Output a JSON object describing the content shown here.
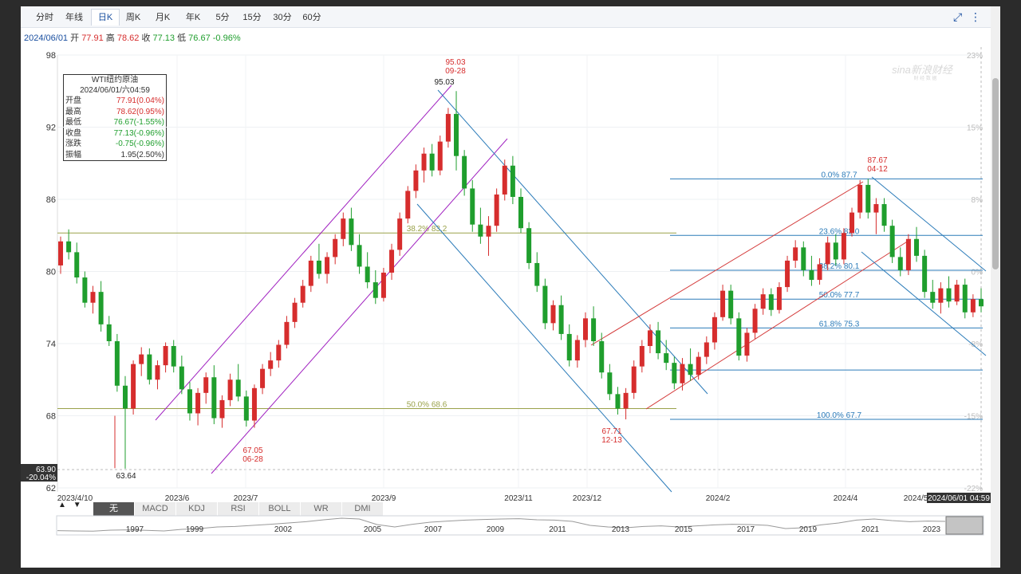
{
  "tabs": [
    {
      "label": "分时"
    },
    {
      "label": "年线"
    },
    {
      "label": "日K",
      "active": true
    },
    {
      "label": "周K"
    },
    {
      "label": "月K"
    },
    {
      "label": "年K"
    },
    {
      "label": "5分"
    },
    {
      "label": "15分"
    },
    {
      "label": "30分"
    },
    {
      "label": "60分"
    }
  ],
  "toolbar": {
    "expand_icon": "fullscreen-icon",
    "more_icon": "more-vertical-icon",
    "expand_glyph": "⤢",
    "more_glyph": "⋮"
  },
  "quote": {
    "date": "2024/06/01",
    "open_label": "开",
    "open": "77.91",
    "high_label": "高",
    "high": "78.62",
    "close_label": "收",
    "close": "77.13",
    "low_label": "低",
    "low": "76.67",
    "change": "-0.96%"
  },
  "infobox": {
    "title": "WTI纽约原油",
    "datetime": "2024/06/01/六04:59",
    "rows": [
      {
        "label": "开盘",
        "value": "77.91(0.04%)",
        "color": "red"
      },
      {
        "label": "最高",
        "value": "78.62(0.95%)",
        "color": "red"
      },
      {
        "label": "最低",
        "value": "76.67(-1.55%)",
        "color": "green"
      },
      {
        "label": "收盘",
        "value": "77.13(-0.96%)",
        "color": "green"
      },
      {
        "label": "涨跌",
        "value": "-0.75(-0.96%)",
        "color": "green"
      },
      {
        "label": "振幅",
        "value": "1.95(2.50%)",
        "color": "black"
      }
    ]
  },
  "chart_data": {
    "type": "candlestick",
    "ylim": [
      62,
      98
    ],
    "y_ticks": [
      98,
      92,
      86,
      80,
      74,
      68,
      62
    ],
    "right_pct_ticks": [
      "23%",
      "15%",
      "8%",
      "0%",
      "-8%",
      "-15%",
      "-22%"
    ],
    "x_tick_labels": [
      "2023/4/10",
      "2023/6",
      "2023/7",
      "2023/9",
      "2023/11",
      "2023/12",
      "2024/2",
      "2024/4",
      "2024/5"
    ],
    "current_price_label": "63.90",
    "current_pct_label": "-20.04%",
    "crosshair_time_label": "2024/06/01 04:59",
    "annotations": [
      {
        "text": "95.03",
        "sub": "09-28",
        "kind": "high"
      },
      {
        "text": "95.03",
        "kind": "peak"
      },
      {
        "text": "67.05",
        "sub": "06-28",
        "kind": "low"
      },
      {
        "text": "67.71",
        "sub": "12-13",
        "kind": "low"
      },
      {
        "text": "87.67",
        "sub": "04-12",
        "kind": "high"
      },
      {
        "text": "63.64",
        "kind": "min"
      }
    ],
    "fib_levels_left": [
      {
        "label": "38.2% 83.2",
        "value": 83.2
      },
      {
        "label": "50.0% 68.6",
        "value": 68.6
      }
    ],
    "fib_levels_right": [
      {
        "label": "0.0% 87.7",
        "value": 87.7
      },
      {
        "label": "23.6% 83.0",
        "value": 83.0
      },
      {
        "label": "38.2% 80.1",
        "value": 80.1
      },
      {
        "label": "50.0% 77.7",
        "value": 77.7
      },
      {
        "label": "61.8% 75.3",
        "value": 75.3
      },
      {
        "label": "",
        "value": 71.8
      },
      {
        "label": "100.0% 67.7",
        "value": 67.7
      }
    ],
    "candles_ohlc": [
      [
        80.5,
        82.9,
        79.8,
        82.5
      ],
      [
        82.5,
        83.5,
        81.0,
        81.6
      ],
      [
        81.6,
        82.4,
        79.0,
        79.5
      ],
      [
        79.5,
        80.0,
        77.0,
        77.4
      ],
      [
        77.4,
        78.8,
        76.5,
        78.3
      ],
      [
        78.3,
        79.2,
        75.0,
        75.6
      ],
      [
        75.6,
        76.3,
        73.8,
        74.2
      ],
      [
        74.2,
        74.8,
        70.0,
        70.5
      ],
      [
        70.5,
        71.3,
        63.6,
        68.6
      ],
      [
        68.6,
        72.6,
        68.1,
        72.3
      ],
      [
        72.3,
        73.7,
        71.3,
        73.1
      ],
      [
        73.1,
        73.6,
        70.6,
        71.0
      ],
      [
        71.0,
        72.6,
        70.2,
        72.2
      ],
      [
        72.2,
        74.1,
        71.6,
        73.8
      ],
      [
        73.8,
        74.3,
        71.6,
        72.1
      ],
      [
        72.1,
        73.0,
        69.8,
        70.2
      ],
      [
        70.2,
        70.8,
        67.6,
        68.2
      ],
      [
        68.2,
        70.3,
        67.2,
        69.9
      ],
      [
        69.9,
        71.6,
        69.0,
        71.2
      ],
      [
        71.2,
        72.2,
        67.3,
        67.8
      ],
      [
        67.8,
        69.7,
        67.0,
        69.3
      ],
      [
        69.3,
        71.5,
        68.8,
        71.0
      ],
      [
        71.0,
        72.3,
        69.2,
        69.6
      ],
      [
        69.6,
        70.1,
        67.1,
        67.6
      ],
      [
        67.6,
        70.6,
        67.0,
        70.3
      ],
      [
        70.3,
        72.3,
        69.8,
        71.9
      ],
      [
        71.9,
        73.3,
        71.3,
        72.6
      ],
      [
        72.6,
        74.3,
        72.0,
        73.9
      ],
      [
        73.9,
        76.3,
        73.6,
        75.8
      ],
      [
        75.8,
        77.8,
        75.3,
        77.4
      ],
      [
        77.4,
        79.3,
        77.0,
        78.8
      ],
      [
        78.8,
        81.3,
        78.3,
        80.9
      ],
      [
        80.9,
        82.3,
        79.4,
        79.8
      ],
      [
        79.8,
        81.6,
        79.0,
        81.2
      ],
      [
        81.2,
        83.1,
        80.6,
        82.7
      ],
      [
        82.7,
        84.9,
        82.1,
        84.4
      ],
      [
        84.4,
        85.3,
        81.7,
        82.2
      ],
      [
        82.2,
        83.1,
        79.8,
        80.4
      ],
      [
        80.4,
        81.6,
        78.6,
        79.1
      ],
      [
        79.1,
        80.1,
        77.3,
        77.8
      ],
      [
        77.8,
        80.3,
        77.5,
        79.9
      ],
      [
        79.9,
        82.3,
        79.3,
        81.8
      ],
      [
        81.8,
        84.9,
        81.3,
        84.4
      ],
      [
        84.4,
        87.1,
        84.0,
        86.7
      ],
      [
        86.7,
        88.9,
        86.1,
        88.4
      ],
      [
        88.4,
        90.3,
        87.4,
        89.8
      ],
      [
        89.8,
        90.6,
        87.9,
        88.4
      ],
      [
        88.4,
        91.3,
        88.0,
        90.8
      ],
      [
        90.8,
        93.6,
        90.3,
        93.1
      ],
      [
        93.1,
        95.0,
        88.4,
        89.6
      ],
      [
        89.6,
        90.1,
        86.3,
        86.9
      ],
      [
        86.9,
        87.6,
        83.3,
        83.9
      ],
      [
        83.9,
        85.3,
        82.3,
        82.9
      ],
      [
        82.9,
        84.6,
        81.3,
        83.8
      ],
      [
        83.8,
        86.9,
        83.3,
        86.4
      ],
      [
        86.4,
        89.3,
        85.9,
        88.8
      ],
      [
        88.8,
        89.6,
        85.6,
        86.2
      ],
      [
        86.2,
        86.9,
        83.2,
        83.6
      ],
      [
        83.6,
        84.1,
        80.2,
        80.7
      ],
      [
        80.7,
        81.6,
        78.3,
        78.8
      ],
      [
        78.8,
        79.4,
        75.2,
        75.7
      ],
      [
        75.7,
        77.6,
        75.1,
        77.2
      ],
      [
        77.2,
        78.0,
        74.3,
        74.8
      ],
      [
        74.8,
        75.6,
        72.1,
        72.6
      ],
      [
        72.6,
        74.7,
        72.0,
        74.3
      ],
      [
        74.3,
        76.6,
        73.7,
        76.1
      ],
      [
        76.1,
        77.1,
        73.8,
        74.2
      ],
      [
        74.2,
        74.9,
        71.1,
        71.6
      ],
      [
        71.6,
        72.3,
        69.3,
        69.8
      ],
      [
        69.8,
        70.4,
        68.1,
        68.6
      ],
      [
        68.6,
        70.3,
        67.7,
        69.9
      ],
      [
        69.9,
        72.6,
        69.4,
        72.1
      ],
      [
        72.1,
        74.3,
        71.6,
        73.8
      ],
      [
        73.8,
        75.6,
        73.2,
        75.1
      ],
      [
        75.1,
        75.8,
        72.7,
        73.2
      ],
      [
        73.2,
        74.3,
        71.8,
        72.4
      ],
      [
        72.4,
        72.9,
        70.2,
        70.7
      ],
      [
        70.7,
        72.8,
        70.1,
        72.3
      ],
      [
        72.3,
        73.6,
        70.9,
        71.4
      ],
      [
        71.4,
        73.3,
        71.0,
        72.9
      ],
      [
        72.9,
        74.6,
        72.3,
        74.1
      ],
      [
        74.1,
        76.6,
        73.5,
        76.2
      ],
      [
        76.2,
        78.9,
        75.9,
        78.4
      ],
      [
        78.4,
        78.9,
        75.6,
        76.1
      ],
      [
        76.1,
        76.6,
        72.6,
        73.0
      ],
      [
        73.0,
        75.3,
        72.5,
        74.9
      ],
      [
        74.9,
        77.3,
        74.4,
        76.9
      ],
      [
        76.9,
        78.6,
        76.4,
        78.1
      ],
      [
        78.1,
        78.6,
        76.3,
        76.8
      ],
      [
        76.8,
        79.1,
        76.5,
        78.7
      ],
      [
        78.7,
        81.3,
        78.3,
        80.9
      ],
      [
        80.9,
        82.6,
        80.3,
        82.0
      ],
      [
        82.0,
        82.5,
        79.6,
        80.1
      ],
      [
        80.1,
        81.3,
        78.8,
        79.3
      ],
      [
        79.3,
        81.1,
        78.9,
        80.6
      ],
      [
        80.6,
        82.9,
        80.1,
        82.4
      ],
      [
        82.4,
        83.1,
        80.5,
        81.0
      ],
      [
        81.0,
        83.6,
        80.6,
        83.2
      ],
      [
        83.2,
        85.3,
        82.9,
        84.9
      ],
      [
        84.9,
        87.6,
        84.4,
        87.2
      ],
      [
        87.2,
        87.7,
        84.4,
        84.9
      ],
      [
        84.9,
        86.1,
        83.1,
        85.6
      ],
      [
        85.6,
        86.1,
        83.3,
        83.8
      ],
      [
        83.8,
        84.3,
        80.7,
        81.2
      ],
      [
        81.2,
        82.0,
        79.6,
        80.1
      ],
      [
        80.1,
        83.1,
        79.7,
        82.7
      ],
      [
        82.7,
        83.7,
        80.8,
        81.3
      ],
      [
        81.3,
        81.8,
        77.8,
        78.3
      ],
      [
        78.3,
        79.3,
        76.9,
        77.4
      ],
      [
        77.4,
        79.1,
        76.5,
        78.6
      ],
      [
        78.6,
        79.6,
        77.0,
        77.5
      ],
      [
        77.5,
        79.3,
        77.2,
        78.9
      ],
      [
        78.9,
        79.4,
        76.1,
        76.6
      ],
      [
        76.6,
        78.1,
        76.2,
        77.7
      ],
      [
        77.7,
        78.6,
        76.6,
        77.1
      ]
    ]
  },
  "indicators": {
    "up_arrow": "▲",
    "down_arrow": "▼",
    "items": [
      {
        "label": "无",
        "active": true
      },
      {
        "label": "MACD"
      },
      {
        "label": "KDJ"
      },
      {
        "label": "RSI"
      },
      {
        "label": "BOLL"
      },
      {
        "label": "WR"
      },
      {
        "label": "DMI"
      }
    ]
  },
  "navigator": {
    "year_labels": [
      "1997",
      "1999",
      "2002",
      "2005",
      "2007",
      "2009",
      "2011",
      "2013",
      "2015",
      "2017",
      "2019",
      "2021",
      "2023"
    ],
    "series": [
      22,
      20,
      19,
      25,
      27,
      24,
      20,
      30,
      35,
      45,
      48,
      55,
      62,
      70,
      78,
      90,
      100,
      95,
      60,
      45,
      62,
      75,
      82,
      88,
      92,
      95,
      97,
      90,
      88,
      80,
      55,
      45,
      40,
      48,
      52,
      45,
      52,
      58,
      62,
      60,
      55,
      35,
      40,
      58,
      70,
      88,
      95,
      85,
      78,
      82,
      80
    ]
  },
  "watermark": {
    "text": "sina新浪财经",
    "sub": "财 经 数 据"
  }
}
